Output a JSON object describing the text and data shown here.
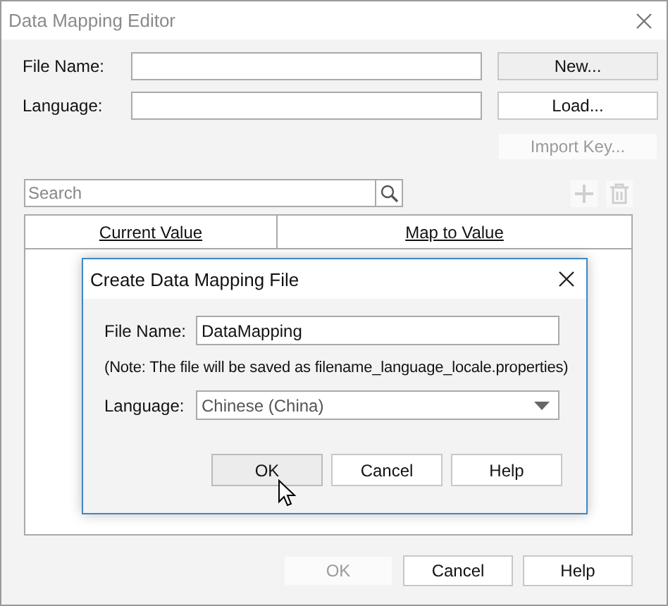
{
  "window": {
    "title": "Data Mapping Editor",
    "active": false
  },
  "form_rows": [
    {
      "label": "File Name:",
      "button": {
        "label": "New...",
        "disabled": false
      }
    },
    {
      "label": "Language:",
      "button": {
        "label": "Load...",
        "disabled": false
      }
    }
  ],
  "import_button": {
    "label": "Import Key...",
    "disabled": true
  },
  "search": {
    "placeholder": "Search"
  },
  "tools": [
    {
      "kind": "add",
      "disabled": true
    },
    {
      "kind": "delete",
      "disabled": true
    }
  ],
  "table": {
    "columns": [
      "Current Value",
      "Map to Value"
    ]
  },
  "buttons": [
    {
      "label": "OK",
      "disabled": true
    },
    {
      "label": "Cancel",
      "disabled": false
    },
    {
      "label": "Help",
      "disabled": false
    }
  ],
  "dialog": {
    "title": "Create Data Mapping File",
    "file_name": {
      "label": "File Name:",
      "value": "DataMapping"
    },
    "note": "(Note: The file will be saved as filename_language_locale.properties)",
    "language": {
      "label": "Language:",
      "value": "Chinese (China)"
    },
    "buttons": [
      {
        "label": "OK",
        "hovered": true
      },
      {
        "label": "Cancel",
        "hovered": false
      },
      {
        "label": "Help",
        "hovered": false
      }
    ]
  }
}
